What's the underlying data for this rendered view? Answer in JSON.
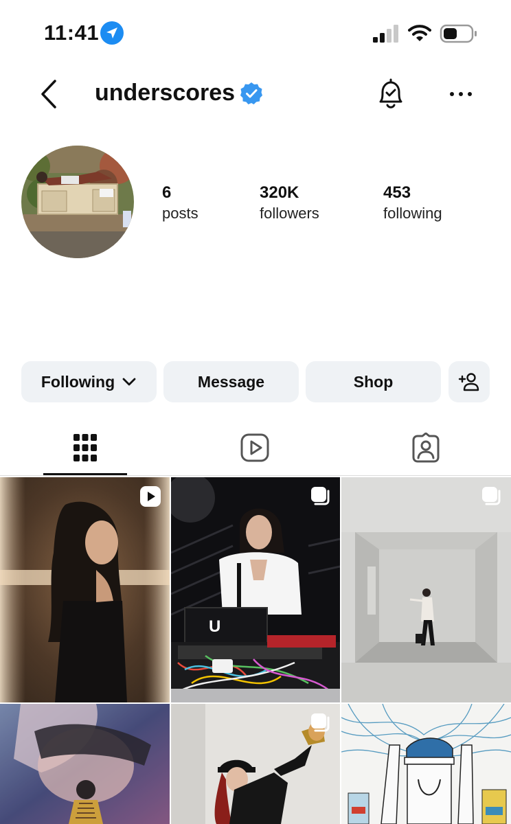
{
  "status_bar": {
    "time": "11:41",
    "icons": [
      "location-arrow-icon",
      "signal-icon",
      "wifi-icon",
      "battery-icon"
    ]
  },
  "header": {
    "username": "underscores",
    "icons": [
      "back-icon",
      "verified-icon",
      "bell-check-icon",
      "more-icon"
    ]
  },
  "profile": {
    "stats": [
      {
        "value": "6",
        "label": "posts"
      },
      {
        "value": "320K",
        "label": "followers"
      },
      {
        "value": "453",
        "label": "following"
      }
    ]
  },
  "actions": {
    "following_label": "Following",
    "message_label": "Message",
    "shop_label": "Shop"
  },
  "tabs": [
    {
      "name": "posts-grid",
      "icon": "grid-icon",
      "active": true
    },
    {
      "name": "reels",
      "icon": "reels-icon",
      "active": false
    },
    {
      "name": "tagged",
      "icon": "tagged-icon",
      "active": false
    }
  ],
  "colors": {
    "verified": "#3897f0",
    "button_bg": "#eff2f5",
    "location": "#1c8cf2"
  },
  "grid": [
    {
      "type": "reel",
      "badge": "reel-icon"
    },
    {
      "type": "carousel",
      "badge": "carousel-icon"
    },
    {
      "type": "carousel",
      "badge": "carousel-icon"
    },
    {
      "type": "photo",
      "badge": ""
    },
    {
      "type": "carousel",
      "badge": "carousel-icon"
    },
    {
      "type": "photo",
      "badge": ""
    }
  ]
}
